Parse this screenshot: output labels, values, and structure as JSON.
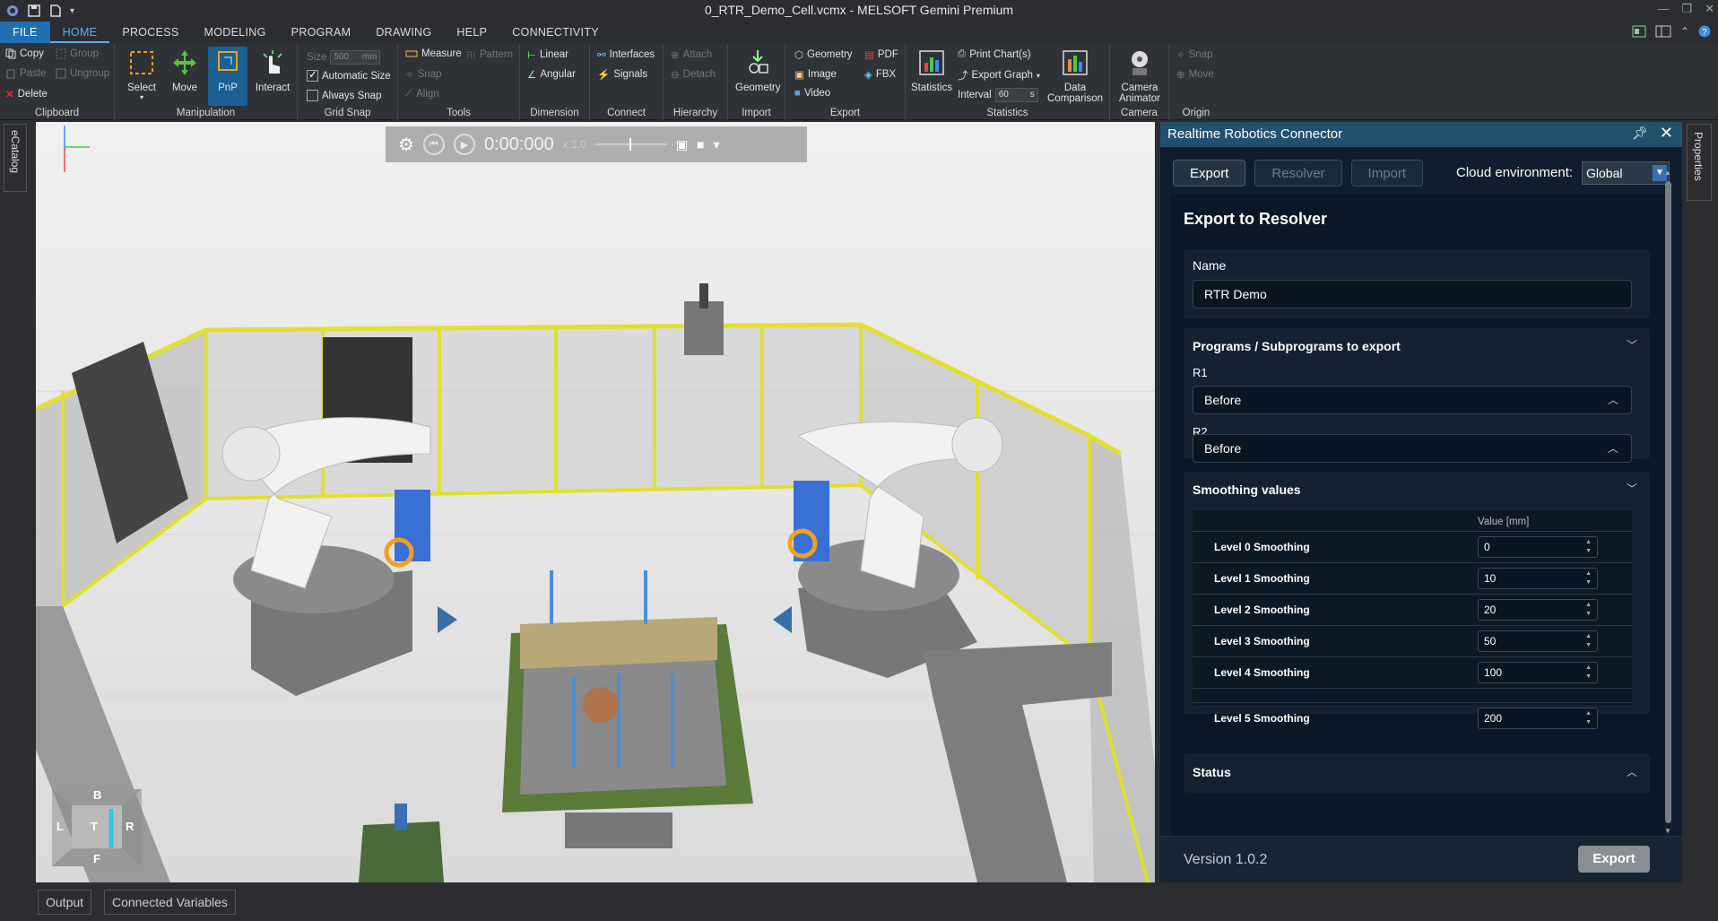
{
  "window": {
    "title": "0_RTR_Demo_Cell.vcmx - MELSOFT Gemini Premium"
  },
  "menu": {
    "tabs": [
      "FILE",
      "HOME",
      "PROCESS",
      "MODELING",
      "PROGRAM",
      "DRAWING",
      "HELP",
      "CONNECTIVITY"
    ],
    "active": "HOME"
  },
  "ribbon": {
    "clipboard": {
      "name": "Clipboard",
      "copy": "Copy",
      "paste": "Paste",
      "delete": "Delete",
      "group": "Group",
      "ungroup": "Ungroup"
    },
    "manipulation": {
      "name": "Manipulation",
      "select": "Select",
      "move": "Move",
      "pnp": "PnP",
      "interact": "Interact"
    },
    "grid_snap": {
      "name": "Grid Snap",
      "size_label": "Size",
      "size_value": "500",
      "size_unit": "mm",
      "auto_size": "Automatic Size",
      "always_snap": "Always Snap"
    },
    "tools": {
      "name": "Tools",
      "measure": "Measure",
      "pattern": "Pattern",
      "snap": "Snap",
      "align": "Align"
    },
    "dimension": {
      "name": "Dimension",
      "linear": "Linear",
      "angular": "Angular"
    },
    "connect": {
      "name": "Connect",
      "interfaces": "Interfaces",
      "signals": "Signals"
    },
    "hierarchy": {
      "name": "Hierarchy",
      "attach": "Attach",
      "detach": "Detach"
    },
    "import": {
      "name": "Import",
      "geometry": "Geometry"
    },
    "export": {
      "name": "Export",
      "geometry": "Geometry",
      "image": "Image",
      "video": "Video",
      "pdf": "PDF",
      "fbx": "FBX"
    },
    "statistics": {
      "name": "Statistics",
      "statistics": "Statistics",
      "print_charts": "Print Chart(s)",
      "export_graph": "Export Graph",
      "interval_label": "Interval",
      "interval_value": "60",
      "interval_unit": "s",
      "data_comparison_1": "Data",
      "data_comparison_2": "Comparison"
    },
    "camera": {
      "name": "Camera",
      "animator_1": "Camera",
      "animator_2": "Animator"
    },
    "origin": {
      "name": "Origin",
      "snap": "Snap",
      "move": "Move"
    }
  },
  "side_tabs": {
    "left": "eCatalog",
    "right": "Properties"
  },
  "viewport": {
    "time": "0:00:000",
    "speed": "x 1.0",
    "navcube": {
      "back": "B",
      "left": "L",
      "top": "T",
      "right": "R",
      "front": "F"
    }
  },
  "panel": {
    "title": "Realtime Robotics Connector",
    "tabs": [
      "Export",
      "Resolver",
      "Import"
    ],
    "cloud_label": "Cloud environment:",
    "cloud_value": "Global",
    "heading": "Export to Resolver",
    "name_label": "Name",
    "name_value": "RTR Demo",
    "programs_title": "Programs / Subprograms to export",
    "r1_label": "R1",
    "r1_value": "Before",
    "r2_label": "R2",
    "r2_value": "Before",
    "smoothing_title": "Smoothing values",
    "smoothing_col": "Value [mm]",
    "smoothing": [
      {
        "label": "Level 0 Smoothing",
        "value": "0"
      },
      {
        "label": "Level 1 Smoothing",
        "value": "10"
      },
      {
        "label": "Level 2 Smoothing",
        "value": "20"
      },
      {
        "label": "Level 3 Smoothing",
        "value": "50"
      },
      {
        "label": "Level 4 Smoothing",
        "value": "100"
      },
      {
        "label": "Level 5 Smoothing",
        "value": "200"
      }
    ],
    "status_title": "Status",
    "version": "Version 1.0.2",
    "export_button": "Export"
  },
  "bottom": {
    "output": "Output",
    "connected_variables": "Connected Variables"
  },
  "colors": {
    "accent": "#1f6fb2",
    "panel_bg": "#0f1d2e",
    "panel_title": "#22516e",
    "fence": "#e0e030"
  }
}
